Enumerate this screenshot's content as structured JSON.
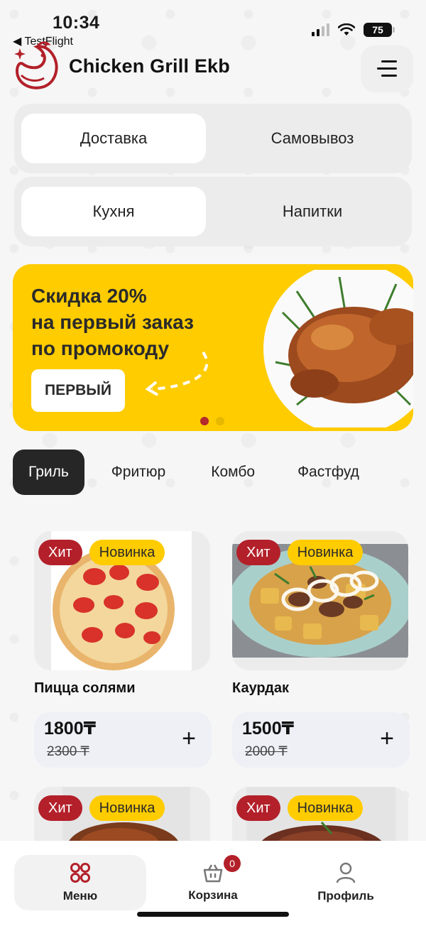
{
  "status_bar": {
    "time": "10:34",
    "back_app": "◀ TestFlight",
    "battery": "75"
  },
  "header": {
    "brand": "Chicken Grill Ekb",
    "logo_icon": "chicken-logo-icon",
    "menu_icon": "hamburger-icon"
  },
  "order_type": {
    "options": [
      "Доставка",
      "Самовывоз"
    ],
    "selected": "Доставка"
  },
  "section_type": {
    "options": [
      "Кухня",
      "Напитки"
    ],
    "selected": "Кухня"
  },
  "banner": {
    "line1": "Скидка 20%",
    "line2": "на первый заказ",
    "line3": "по промокоду",
    "promo_code": "ПЕРВЫЙ",
    "slides_total": 2,
    "active_slide": 1
  },
  "categories": {
    "items": [
      "Гриль",
      "Фритюр",
      "Комбо",
      "Фастфуд"
    ],
    "selected": "Гриль"
  },
  "products": [
    {
      "name": "Пицца солями",
      "price": "1800₸",
      "old_price": "2300 ₸",
      "badge_hit": "Хит",
      "badge_new": "Новинка",
      "image": "pizza"
    },
    {
      "name": "Каурдак",
      "price": "1500₸",
      "old_price": "2000 ₸",
      "badge_hit": "Хит",
      "badge_new": "Новинка",
      "image": "kuyrdak"
    },
    {
      "name": "",
      "price": "",
      "old_price": "",
      "badge_hit": "Хит",
      "badge_new": "Новинка",
      "image": "grilled-meat"
    },
    {
      "name": "",
      "price": "",
      "old_price": "",
      "badge_hit": "Хит",
      "badge_new": "Новинка",
      "image": "steak"
    }
  ],
  "bottom_nav": {
    "menu": "Меню",
    "cart": "Корзина",
    "cart_count": "0",
    "profile": "Профиль",
    "active": "Меню"
  },
  "colors": {
    "brand_red": "#b3202a",
    "accent_yellow": "#ffcc00",
    "dark_chip": "#262626"
  }
}
